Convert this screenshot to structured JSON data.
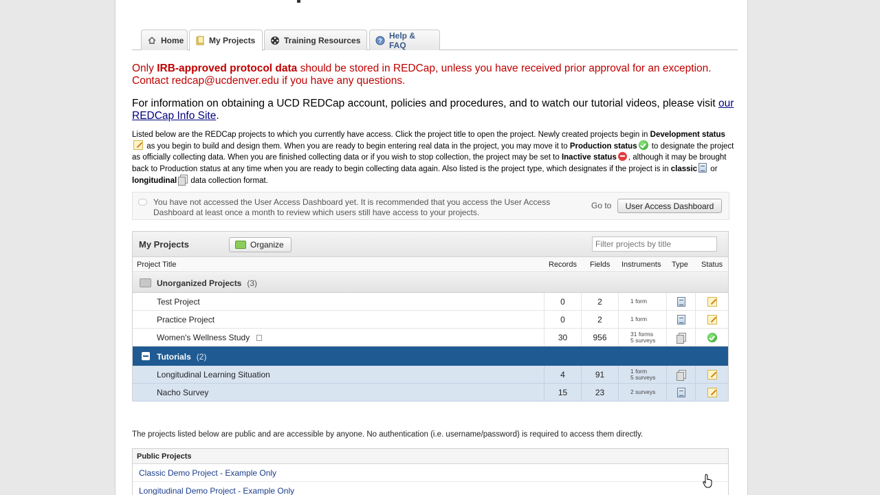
{
  "tabs": [
    {
      "label": "Home",
      "icon": "home-icon"
    },
    {
      "label": "My Projects",
      "icon": "folder-icon"
    },
    {
      "label": "Training Resources",
      "icon": "film-reel-icon"
    },
    {
      "label": "Help & FAQ",
      "icon": "help-icon"
    }
  ],
  "notice_red": {
    "part1": "Only ",
    "bold": "IRB-approved protocol data",
    "part2": " should be stored in REDCap, unless you have received prior approval for an exception. Contact redcap@ucdenver.edu if you have any questions."
  },
  "notice_info": {
    "text": "For information on obtaining a UCD REDCap account, policies and procedures, and to watch our tutorial videos, please visit ",
    "link": "our REDCap Info Site",
    "end": "."
  },
  "intro": {
    "t1": "Listed below are the REDCap projects to which you currently have access. Click the project title to open the project. Newly created projects begin in ",
    "dev": "Development status",
    "t2": " as you begin to build and design them. When you are ready to begin entering real data in the project, you may move it to ",
    "prod": "Production status",
    "t3": " to designate the project as officially collecting data. When you are finished collecting data or if you wish to stop collection, the project may be set to ",
    "inactive": "Inactive status",
    "t4": ", although it may be brought back to Production status at any time when you are ready to begin collecting data again. Also listed is the project type, which designates if the project is in ",
    "classic": "classic",
    "t5": " or ",
    "longitudinal": "longitudinal",
    "t6": " data collection format."
  },
  "dashboard": {
    "message": "You have not accessed the User Access Dashboard yet. It is recommended that you access the User Access Dashboard at least once a month to review which users still have access to your projects.",
    "goto": "Go to",
    "button": "User Access Dashboard"
  },
  "my_projects": {
    "title": "My Projects",
    "organize": "Organize",
    "filter_placeholder": "Filter projects by title",
    "columns": [
      "Project Title",
      "Records",
      "Fields",
      "Instruments",
      "Type",
      "Status"
    ],
    "folders": [
      {
        "name": "Unorganized Projects",
        "count": "(3)",
        "projects": [
          {
            "title": "Test Project",
            "records": "0",
            "fields": "2",
            "instruments": [
              "1 form"
            ],
            "type": "classic",
            "status": "development"
          },
          {
            "title": "Practice Project",
            "records": "0",
            "fields": "2",
            "instruments": [
              "1 form"
            ],
            "type": "classic",
            "status": "development"
          },
          {
            "title": "Women's Wellness Study",
            "records": "30",
            "fields": "956",
            "instruments": [
              "31 forms",
              "5 surveys"
            ],
            "type": "longitudinal",
            "status": "production"
          }
        ]
      },
      {
        "name": "Tutorials",
        "count": "(2)",
        "projects": [
          {
            "title": "Longitudinal Learning Situation",
            "records": "4",
            "fields": "91",
            "instruments": [
              "1 form",
              "5 surveys"
            ],
            "type": "longitudinal",
            "status": "development"
          },
          {
            "title": "Nacho Survey",
            "records": "15",
            "fields": "23",
            "instruments": [
              "2 surveys"
            ],
            "type": "classic",
            "status": "development"
          }
        ]
      }
    ]
  },
  "public": {
    "intro": "The projects listed below are public and are accessible by anyone. No authentication (i.e. username/password) is required to access them directly.",
    "title": "Public Projects",
    "projects": [
      "Classic Demo Project - Example Only",
      "Longitudinal Demo Project - Example Only"
    ]
  }
}
